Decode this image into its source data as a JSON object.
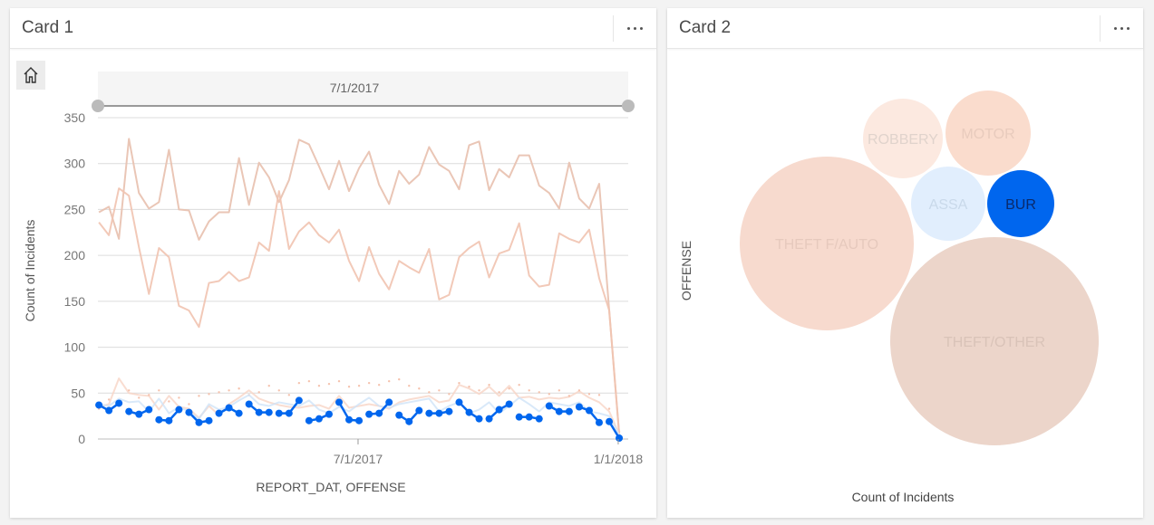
{
  "cards": [
    {
      "title": "Card 1",
      "menu_icon": "more-horizontal-icon",
      "home_icon": "home-icon",
      "time_slider": {
        "label": "7/1/2017",
        "range_start": "full",
        "range_end": "full"
      }
    },
    {
      "title": "Card 2",
      "menu_icon": "more-horizontal-icon"
    }
  ],
  "colors": {
    "highlight": "#0066ee",
    "pale_orange": "#f0c8b8",
    "grid": "#d8d8d8",
    "axis_text": "#777777"
  },
  "chart_data": [
    {
      "type": "line",
      "title": "",
      "xlabel": "REPORT_DAT, OFFENSE",
      "ylabel": "Count of Incidents",
      "ylim": [
        0,
        350
      ],
      "yticks": [
        0,
        50,
        100,
        150,
        200,
        250,
        300,
        350
      ],
      "xticks": [
        "7/1/2017",
        "1/1/2018"
      ],
      "x_range_weeks": [
        0,
        53
      ],
      "xtick_positions_weeks": [
        26,
        52
      ],
      "grid": true,
      "series": [
        {
          "name": "THEFT/OTHER",
          "color": "#e8c0ae",
          "values": [
            247,
            253,
            218,
            327,
            268,
            251,
            258,
            315,
            250,
            249,
            217,
            237,
            247,
            247,
            306,
            255,
            301,
            285,
            258,
            282,
            326,
            321,
            297,
            272,
            303,
            270,
            295,
            313,
            277,
            256,
            292,
            278,
            288,
            318,
            299,
            292,
            272,
            320,
            324,
            271,
            294,
            285,
            309,
            309,
            276,
            268,
            251,
            301,
            262,
            251,
            278,
            140,
            5
          ]
        },
        {
          "name": "THEFT F/AUTO",
          "color": "#f1c3b0",
          "values": [
            236,
            222,
            273,
            265,
            209,
            158,
            208,
            198,
            145,
            140,
            122,
            170,
            172,
            182,
            172,
            176,
            214,
            205,
            270,
            207,
            226,
            236,
            222,
            214,
            228,
            194,
            172,
            209,
            180,
            163,
            194,
            187,
            181,
            207,
            152,
            157,
            198,
            208,
            215,
            176,
            202,
            206,
            235,
            178,
            166,
            168,
            224,
            218,
            214,
            228,
            175,
            140,
            5
          ]
        },
        {
          "name": "BURGLARY",
          "color": "#0066ee",
          "highlighted": true,
          "values": [
            37,
            31,
            39,
            30,
            27,
            32,
            21,
            20,
            32,
            29,
            18,
            20,
            28,
            34,
            28,
            38,
            29,
            29,
            28,
            28,
            42,
            20,
            22,
            27,
            40,
            21,
            20,
            27,
            28,
            40,
            26,
            19,
            31,
            28,
            28,
            30,
            40,
            29,
            22,
            22,
            32,
            38,
            24,
            24,
            22,
            36,
            30,
            30,
            35,
            31,
            18,
            19,
            1
          ]
        },
        {
          "name": "MOTOR VEHICLE THEFT",
          "color": "#f7d4c5",
          "dotted": false,
          "values": [
            35,
            38,
            66,
            50,
            48,
            47,
            32,
            47,
            35,
            33,
            23,
            36,
            26,
            38,
            45,
            53,
            44,
            40,
            37,
            35,
            34,
            36,
            37,
            33,
            47,
            34,
            36,
            38,
            36,
            33,
            40,
            43,
            45,
            47,
            40,
            42,
            59,
            55,
            49,
            57,
            47,
            58,
            45,
            46,
            43,
            45,
            44,
            46,
            52,
            45,
            40,
            30,
            5
          ]
        },
        {
          "name": "ROBBERY",
          "color": "#f5c2ad",
          "dotted": true,
          "values": [
            30,
            40,
            35,
            50,
            42,
            45,
            50,
            38,
            42,
            35,
            44,
            46,
            48,
            50,
            52,
            45,
            48,
            55,
            50,
            45,
            58,
            60,
            55,
            57,
            60,
            54,
            55,
            58,
            56,
            60,
            62,
            55,
            52,
            48,
            50,
            46,
            58,
            54,
            50,
            56,
            48,
            52,
            56,
            50,
            48,
            46,
            50,
            44,
            50,
            46,
            45,
            30,
            5
          ]
        },
        {
          "name": "ASSAULT W/DANGEROUS WEAPON",
          "color": "#cfe3f7",
          "values": [
            38,
            36,
            44,
            40,
            41,
            30,
            44,
            28,
            35,
            30,
            22,
            38,
            32,
            35,
            42,
            48,
            38,
            36,
            40,
            38,
            36,
            42,
            32,
            28,
            35,
            30,
            38,
            45,
            36,
            34,
            38,
            40,
            42,
            44,
            30,
            36,
            40,
            28,
            32,
            40,
            28,
            36,
            45,
            38,
            30,
            40,
            38,
            36,
            40,
            30,
            28,
            25,
            5
          ]
        }
      ]
    },
    {
      "type": "bubble",
      "title": "",
      "xlabel": "Count of Incidents",
      "ylabel": "OFFENSE",
      "bubbles": [
        {
          "label": "THEFT/OTHER",
          "relative_size": 1.0,
          "color": "#ecd5ca",
          "label_color": "#d9c3b8"
        },
        {
          "label": "THEFT F/AUTO",
          "relative_size": 0.78,
          "color": "#f7dace",
          "label_color": "#e6c9bd"
        },
        {
          "label": "MOTOR",
          "relative_size": 0.18,
          "color": "#fadccd",
          "label_color": "#e8cbbd"
        },
        {
          "label": "ROBBERY",
          "relative_size": 0.17,
          "color": "#fce9e0",
          "label_color": "#e0d3cc"
        },
        {
          "label": "ASSA",
          "relative_size": 0.15,
          "color": "#e1eefd",
          "label_color": "#c9d9ea"
        },
        {
          "label": "BUR",
          "relative_size": 0.12,
          "color": "#0066ee",
          "label_color": "#0a2a6b",
          "highlighted": true
        }
      ]
    }
  ]
}
